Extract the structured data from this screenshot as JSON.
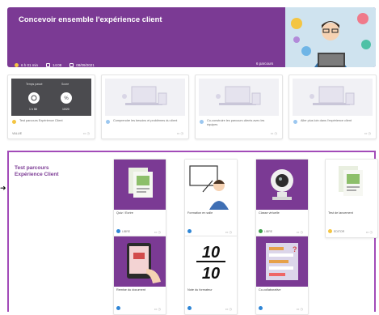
{
  "header": {
    "title": "Concevoir ensemble l'expérience client",
    "stats": [
      "6 h 01 min",
      "14:08",
      "08/09/2021"
    ],
    "count_label": "6 parcours",
    "brand_color": "#7b3a94"
  },
  "top_cards": [
    {
      "caption": "Test parcours Expérience Client",
      "footer": "VALUE",
      "dot": "yellow",
      "thumb_dark": true,
      "thumb_labels": [
        "Temps passé",
        "Score"
      ],
      "thumb_values": [
        "1 h 58",
        "10/20"
      ]
    },
    {
      "caption": "Comprendre les besoins et problèmes du client",
      "footer": "",
      "dot": "blue",
      "thumb_dark": false
    },
    {
      "caption": "Co-construire les parcours clients avec les équipes",
      "footer": "",
      "dot": "blue",
      "thumb_dark": false
    },
    {
      "caption": "Aller plus loin dans l'expérience client",
      "footer": "",
      "dot": "blue",
      "thumb_dark": false
    }
  ],
  "section": {
    "title_line1": "Test parcours",
    "title_line2": "Expérience Client"
  },
  "modules": [
    {
      "label": "Quiz / Ecrire",
      "foot": "LIBRE",
      "dot": "blue",
      "icon": "document-icon"
    },
    {
      "label": "Formation en salle",
      "foot": "",
      "dot": "blue",
      "icon": "trainer-icon"
    },
    {
      "label": "Classe virtuelle",
      "foot": "LIBRE",
      "dot": "green",
      "icon": "webcam-icon"
    },
    {
      "label": "Test de lancement",
      "foot": "EDITOR",
      "dot": "yellow",
      "icon": "document-icon"
    },
    {
      "label": "Remise du document",
      "foot": "",
      "dot": "blue",
      "icon": "tablet-icon"
    },
    {
      "label": "Note du formateur",
      "foot": "",
      "dot": "blue",
      "icon": "score-icon"
    },
    {
      "label": "Co-collaborative",
      "foot": "",
      "dot": "blue",
      "icon": "board-icon"
    }
  ],
  "score_text": {
    "top": "10",
    "bottom": "10"
  }
}
